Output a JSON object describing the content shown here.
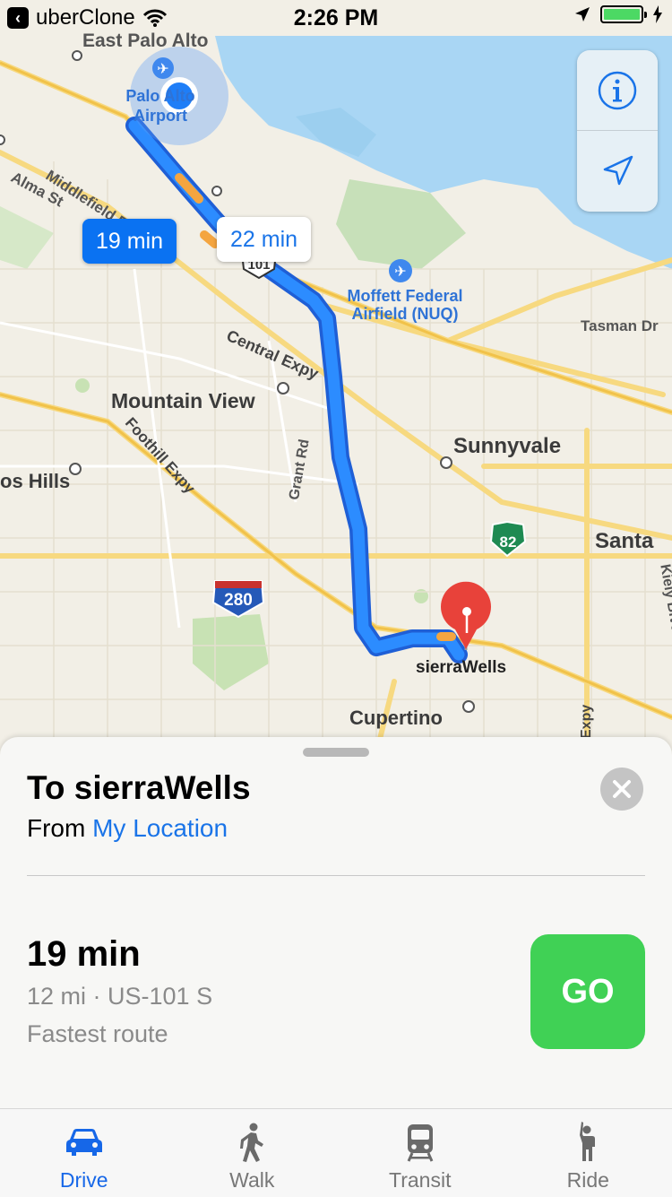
{
  "status_bar": {
    "back_app": "uberClone",
    "time": "2:26 PM",
    "battery_level": 1.0
  },
  "map": {
    "labels": {
      "east_palo_alto": "East Palo Alto",
      "palo_alto_airport": "Palo Alto Airport",
      "middlefield_rd": "Middlefield Rd",
      "alma_st": "Alma St",
      "moffett": "Moffett Federal Airfield (NUQ)",
      "tasman_dr": "Tasman Dr",
      "central_expy": "Central Expy",
      "mountain_view": "Mountain View",
      "sunnyvale": "Sunnyvale",
      "foothill_expy": "Foothill Expy",
      "los_altos_hills": "os Hills",
      "grant_rd": "Grant Rd",
      "santa": "Santa",
      "kiely_blvd": "Kiely Blvd",
      "destination": "sierraWells",
      "cupertino": "Cupertino",
      "expy": "Expy",
      "hwy_82": "82",
      "i_280": "280",
      "us_101": "101"
    },
    "route_bubbles": {
      "primary": "19 min",
      "alternate": "22 min"
    },
    "controls": {
      "info_icon": "info-icon",
      "location_icon": "location-arrow-icon"
    }
  },
  "directions_sheet": {
    "title": "To sierraWells",
    "from_label": "From",
    "from_value": "My Location",
    "route": {
      "time": "19 min",
      "detail": "12 mi · US-101 S",
      "note": "Fastest route"
    },
    "go_label": "GO"
  },
  "tabs": [
    {
      "label": "Drive",
      "icon": "car-icon",
      "active": true
    },
    {
      "label": "Walk",
      "icon": "walk-icon",
      "active": false
    },
    {
      "label": "Transit",
      "icon": "train-icon",
      "active": false
    },
    {
      "label": "Ride",
      "icon": "ride-icon",
      "active": false
    }
  ],
  "colors": {
    "accent": "#1a74e8",
    "route": "#1f7ef7",
    "go": "#40d155",
    "pin": "#e8423a"
  }
}
